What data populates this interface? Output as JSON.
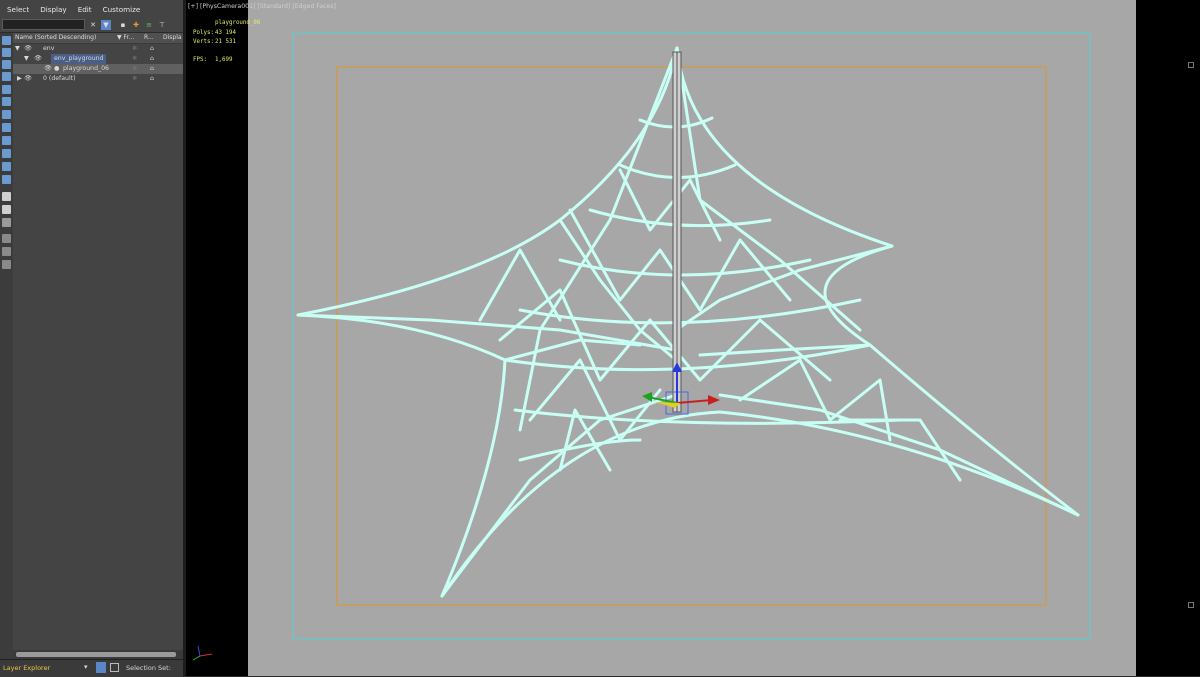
{
  "menubar": {
    "items": [
      "Select",
      "Display",
      "Edit",
      "Customize"
    ]
  },
  "tree": {
    "headers": {
      "name": "Name (Sorted Descending)",
      "frozen": "▼ Fr...",
      "render": "R...",
      "display": "Displa"
    },
    "rows": [
      {
        "label": "env"
      },
      {
        "label": "env_playground"
      },
      {
        "label": "playground_06"
      },
      {
        "label": "0 (default)"
      }
    ]
  },
  "statusbar": {
    "explorer": "Layer Explorer",
    "selection_set": "Selection Set:"
  },
  "viewport": {
    "label": "[+] [PhysCamera001] [Standard] [Edged Faces]",
    "object_name": "playground_06",
    "stats": {
      "polys_label": "Polys:",
      "polys_value": "43 194",
      "verts_label": "Verts:",
      "verts_value": "21 531",
      "fps_label": "FPS:",
      "fps_value": "1,699"
    }
  },
  "colors": {
    "wire": "#c8fff4",
    "safe_frame_outer": "#5ad2d2",
    "safe_frame_inner": "#d89a2a",
    "viewport_bg": "#a7a7a7"
  }
}
